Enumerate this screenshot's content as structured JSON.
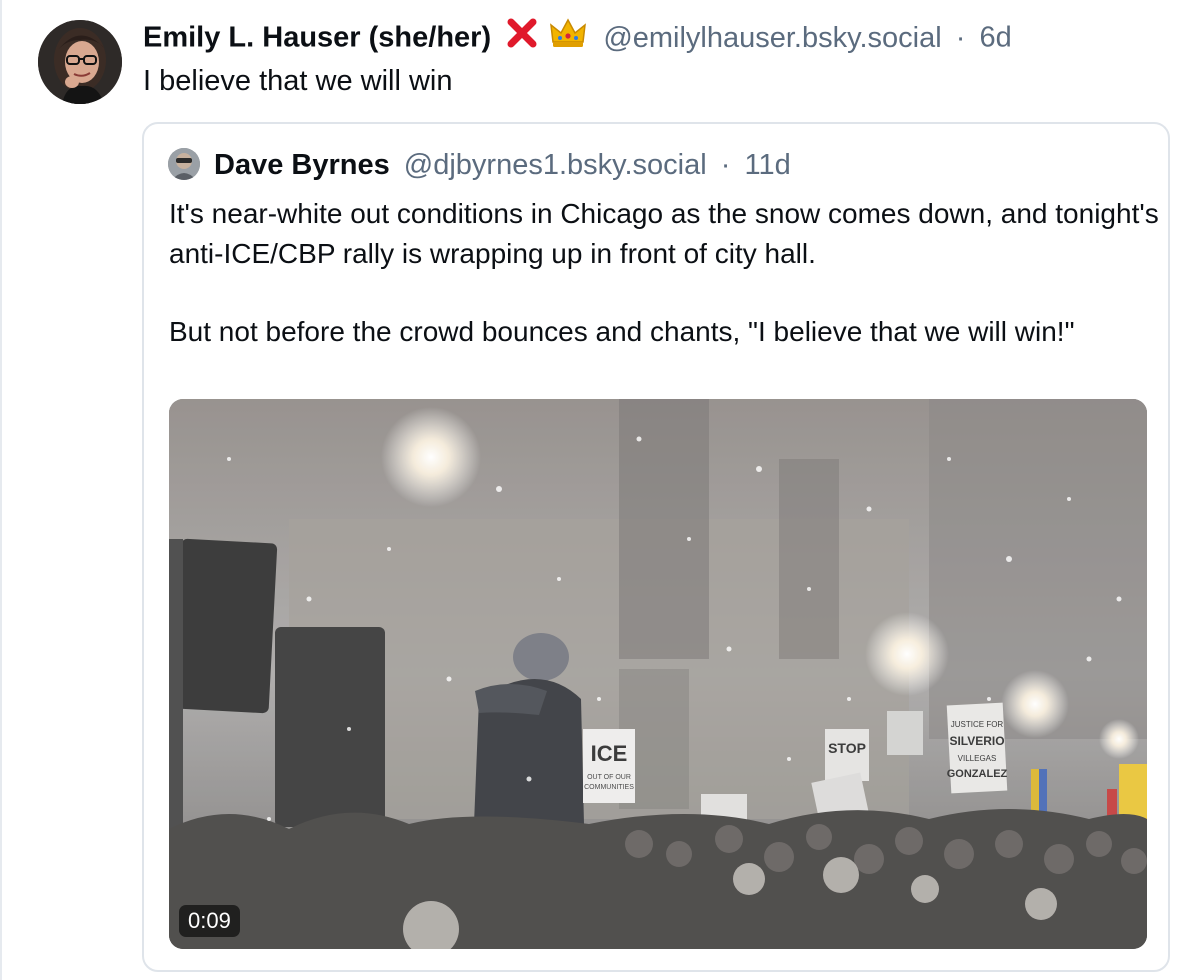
{
  "post": {
    "author_name": "Emily L. Hauser (she/her)",
    "emoji": [
      "cross-mark",
      "crown"
    ],
    "handle": "@emilylhauser.bsky.social",
    "separator": "·",
    "time": "6d",
    "text": "I believe that we will win"
  },
  "quoted_post": {
    "author_name": "Dave Byrnes",
    "handle": "@djbyrnes1.bsky.social",
    "separator": "·",
    "time": "11d",
    "paragraphs": [
      "It's near-white out conditions in Chicago as the snow comes down, and tonight's anti-ICE/CBP rally is wrapping up in front of city hall.",
      "But not before the crowd bounces and chants, \"I believe that we will win!\""
    ],
    "video": {
      "duration": "0:09",
      "signs": [
        "ICE",
        "OUT OF OUR COMMUNITIES",
        "STOP",
        "JUSTICE FOR SILVERIO VILLEGAS GONZALEZ"
      ]
    }
  },
  "colors": {
    "text": "#0b0f14",
    "muted": "#5b6b7e",
    "border": "#dfe4ea",
    "cross_mark": "#e0192b",
    "crown": "#f2b400"
  }
}
